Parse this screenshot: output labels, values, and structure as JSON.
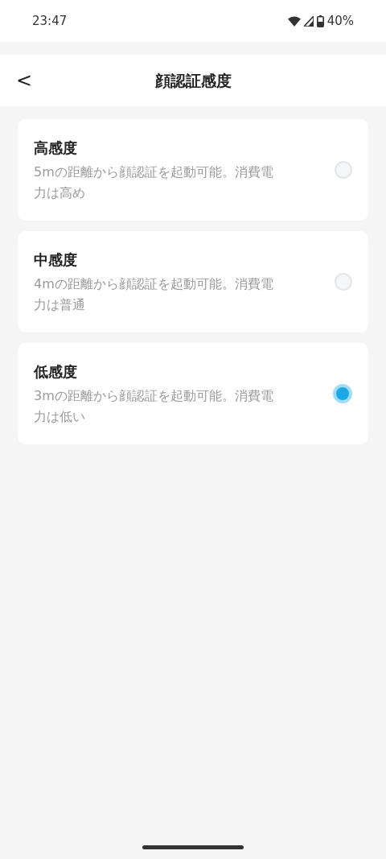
{
  "status_bar": {
    "time": "23:47",
    "battery": "40%"
  },
  "header": {
    "back": "<",
    "title": "顔認証感度"
  },
  "options": [
    {
      "title": "高感度",
      "description": "5mの距離から顔認証を起動可能。消費電力は高め",
      "selected": false
    },
    {
      "title": "中感度",
      "description": "4mの距離から顔認証を起動可能。消費電力は普通",
      "selected": false
    },
    {
      "title": "低感度",
      "description": "3mの距離から顔認証を起動可能。消費電力は低い",
      "selected": true
    }
  ]
}
